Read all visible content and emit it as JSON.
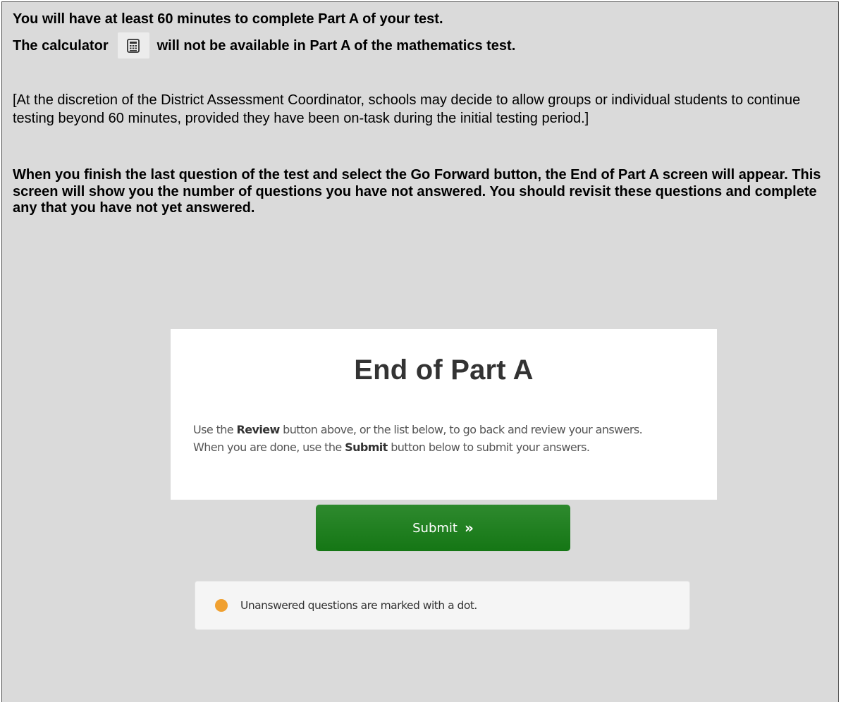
{
  "line1": "You will have at least 60 minutes to complete Part A of your test.",
  "calculator_line": {
    "before": "The calculator",
    "icon": "calculator-icon",
    "after": "will not be available in Part A of the mathematics test."
  },
  "discretion_note": "[At the discretion of the District Assessment Coordinator, schools may decide to allow groups or individual students to continue testing beyond 60 minutes, provided they have been on-task during the initial testing period.]",
  "finish_instructions": "When you finish the last question of the test and select the Go Forward button, the End of Part A screen will appear. This screen will show you the number of questions you have not answered. You should revisit these questions and complete any that you have not yet answered.",
  "end_screen": {
    "title": "End of Part A",
    "desc_line1": {
      "pre": "Use the ",
      "bold": "Review",
      "post": " button above, or the list below, to go back and review your answers."
    },
    "desc_line2": {
      "pre": "When you are done, use the ",
      "bold": "Submit",
      "post": " button below to submit your answers."
    },
    "submit_label": "Submit",
    "submit_icon": "double-chevron-right-icon",
    "legend_text": "Unanswered questions are marked with a dot.",
    "legend_icon": "unanswered-dot-icon"
  },
  "colors": {
    "background": "#dadada",
    "submit_button": "#1f7f1f",
    "unanswered_dot": "#f0a030"
  }
}
